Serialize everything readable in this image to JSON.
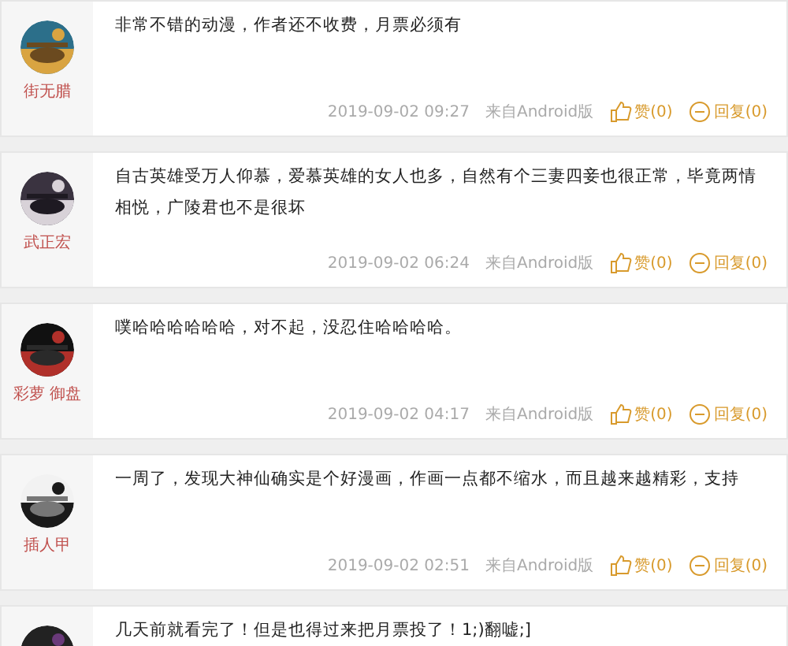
{
  "comments": [
    {
      "user": "街无腊",
      "text": "非常不错的动漫，作者还不收费，月票必须有",
      "time": "2019-09-02 09:27",
      "source": "来自Android版",
      "like": "赞(0)",
      "reply": "回复(0)"
    },
    {
      "user": "武正宏",
      "text": "自古英雄受万人仰慕，爱慕英雄的女人也多，自然有个三妻四妾也很正常，毕竟两情相悦，广陵君也不是很坏",
      "time": "2019-09-02 06:24",
      "source": "来自Android版",
      "like": "赞(0)",
      "reply": "回复(0)"
    },
    {
      "user": "彩萝 御盘",
      "text": "噗哈哈哈哈哈哈，对不起，没忍住哈哈哈哈。",
      "time": "2019-09-02 04:17",
      "source": "来自Android版",
      "like": "赞(0)",
      "reply": "回复(0)"
    },
    {
      "user": "插人甲",
      "text": "一周了，发现大神仙确实是个好漫画，作画一点都不缩水，而且越来越精彩，支持",
      "time": "2019-09-02 02:51",
      "source": "来自Android版",
      "like": "赞(0)",
      "reply": "回复(0)"
    },
    {
      "text": "几天前就看完了！但是也得过来把月票投了！1;)翻嘘;]"
    }
  ]
}
